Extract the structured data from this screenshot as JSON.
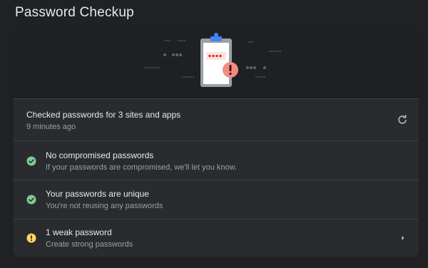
{
  "page": {
    "title": "Password Checkup"
  },
  "colors": {
    "accent_blue": "#4285f4",
    "safe_green": "#81c995",
    "warning_yellow": "#fdd663",
    "danger_red": "#f28b82"
  },
  "summary": {
    "title": "Checked passwords for 3 sites and apps",
    "subtitle": "9 minutes ago",
    "action_icon": "refresh-icon"
  },
  "checks": [
    {
      "title": "No compromised passwords",
      "subtitle": "If your passwords are compromised, we'll let you know.",
      "status": "safe",
      "icon": "check-circle-icon"
    },
    {
      "title": "Your passwords are unique",
      "subtitle": "You're not reusing any passwords",
      "status": "safe",
      "icon": "check-circle-icon"
    },
    {
      "title": "1 weak password",
      "subtitle": "Create strong passwords",
      "status": "warning",
      "icon": "warning-circle-icon",
      "action_icon": "chevron-right-icon"
    }
  ]
}
